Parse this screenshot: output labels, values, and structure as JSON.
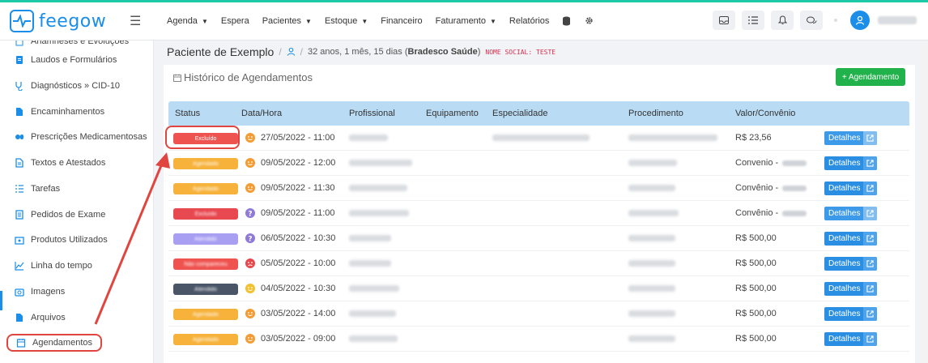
{
  "app": {
    "logo_text": "feegow",
    "brand_color": "#1a8ee8"
  },
  "nav": [
    {
      "label": "Agenda",
      "caret": true
    },
    {
      "label": "Espera",
      "caret": false
    },
    {
      "label": "Pacientes",
      "caret": true
    },
    {
      "label": "Estoque",
      "caret": true
    },
    {
      "label": "Financeiro",
      "caret": false
    },
    {
      "label": "Faturamento",
      "caret": true
    },
    {
      "label": "Relatórios",
      "caret": false
    }
  ],
  "sidebar": {
    "items": [
      {
        "label": "Anamneses e Evoluções",
        "icon": "clipboard-icon"
      },
      {
        "label": "Laudos e Formulários",
        "icon": "report-icon"
      },
      {
        "label": "Diagnósticos » CID-10",
        "icon": "stethoscope-icon"
      },
      {
        "label": "Encaminhamentos",
        "icon": "file-icon"
      },
      {
        "label": "Prescrições Medicamentosas",
        "icon": "pills-icon"
      },
      {
        "label": "Textos e Atestados",
        "icon": "document-icon"
      },
      {
        "label": "Tarefas",
        "icon": "tasks-icon"
      },
      {
        "label": "Pedidos de Exame",
        "icon": "exam-icon"
      },
      {
        "label": "Produtos Utilizados",
        "icon": "box-icon"
      },
      {
        "label": "Linha do tempo",
        "icon": "chart-line-icon"
      },
      {
        "label": "Imagens",
        "icon": "camera-icon"
      },
      {
        "label": "Arquivos",
        "icon": "file-icon"
      },
      {
        "label": "Agendamentos",
        "icon": "calendar-icon"
      }
    ]
  },
  "patient": {
    "name": "Paciente de Exemplo",
    "age": "32 anos, 1 mês, 15 dias (",
    "insurance": "Bradesco Saúde",
    "age_close": ")",
    "social_name": "NOME SOCIAL: Teste"
  },
  "panel": {
    "title": "Histórico de Agendamentos",
    "new_button": "+ Agendamento"
  },
  "table": {
    "headers": [
      "Status",
      "Data/Hora",
      "Profissional",
      "Equipamento",
      "Especialidade",
      "Procedimento",
      "Valor/Convênio"
    ],
    "details_label": "Detalhes",
    "rows": [
      {
        "status": "Excluído",
        "status_color": "#ef5350",
        "emoji_color": "#f39c34",
        "datetime": "27/05/2022 - 11:00",
        "valor": "R$ 23,56",
        "blur_tail": false,
        "light_btn": true
      },
      {
        "status": "Agendado",
        "status_color": "#f6b23a",
        "emoji_color": "#f39c34",
        "datetime": "09/05/2022 - 12:00",
        "valor": "Convenio - ",
        "blur_tail": true,
        "light_btn": false
      },
      {
        "status": "Agendado",
        "status_color": "#f6b23a",
        "emoji_color": "#f39c34",
        "datetime": "09/05/2022 - 11:30",
        "valor": "Convênio - ",
        "blur_tail": true,
        "light_btn": false
      },
      {
        "status": "Excluído",
        "status_color": "#e84850",
        "emoji_color": "#8f7ad8",
        "datetime": "09/05/2022 - 11:00",
        "valor": "Convênio - ",
        "blur_tail": true,
        "light_btn": true
      },
      {
        "status": "Atendido",
        "status_color": "#a89ef2",
        "emoji_color": "#8f7ad8",
        "datetime": "06/05/2022 - 10:30",
        "valor": "R$ 500,00",
        "blur_tail": false,
        "light_btn": false
      },
      {
        "status": "Não compareceu",
        "status_color": "#ef5350",
        "emoji_color": "#e5484d",
        "datetime": "05/05/2022 - 10:00",
        "valor": "R$ 500,00",
        "blur_tail": false,
        "light_btn": false
      },
      {
        "status": "Atendido",
        "status_color": "#4a5568",
        "emoji_color": "#f2c12e",
        "datetime": "04/05/2022 - 10:30",
        "valor": "R$ 500,00",
        "blur_tail": false,
        "light_btn": false
      },
      {
        "status": "Agendado",
        "status_color": "#f6b23a",
        "emoji_color": "#f39c34",
        "datetime": "03/05/2022 - 14:00",
        "valor": "R$ 500,00",
        "blur_tail": false,
        "light_btn": false
      },
      {
        "status": "Agendado",
        "status_color": "#f6b23a",
        "emoji_color": "#f39c34",
        "datetime": "03/05/2022 - 09:00",
        "valor": "R$ 500,00",
        "blur_tail": false,
        "light_btn": false
      }
    ]
  },
  "colors": {
    "highlight_red": "#e0463f",
    "header_bg": "#b9dbf4",
    "new_button_bg": "#22b24c",
    "details_bg": "#2a8fe3"
  }
}
